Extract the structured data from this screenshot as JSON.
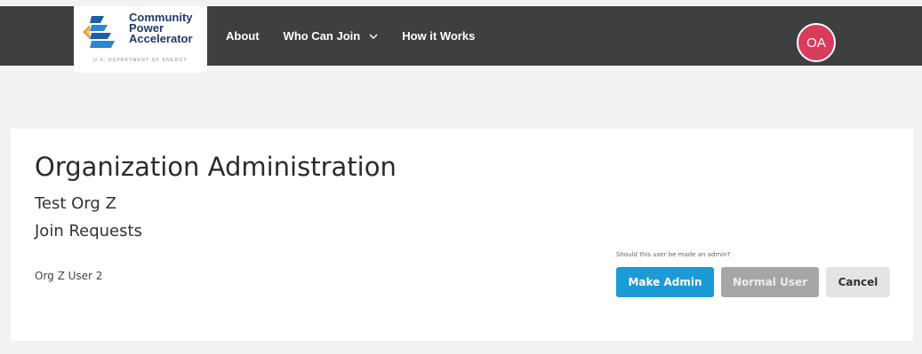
{
  "header": {
    "logo": {
      "line1": "Community",
      "line2": "Power",
      "line3": "Accelerator",
      "subtitle": "U.S. DEPARTMENT OF ENERGY"
    },
    "nav": [
      {
        "label": "About"
      },
      {
        "label": "Who Can Join"
      },
      {
        "label": "How it Works"
      }
    ],
    "avatar_initials": "OA",
    "avatar_color": "#d93b5b",
    "bar_color": "#3e3f41"
  },
  "main": {
    "title": "Organization Administration",
    "org_name": "Test Org Z",
    "section_title": "Join Requests",
    "requests": [
      {
        "user": "Org Z User 2",
        "prompt": "Should this user be made an admin?",
        "make_admin_label": "Make Admin",
        "normal_user_label": "Normal User",
        "cancel_label": "Cancel"
      }
    ],
    "accent_color": "#1a9ad6"
  }
}
